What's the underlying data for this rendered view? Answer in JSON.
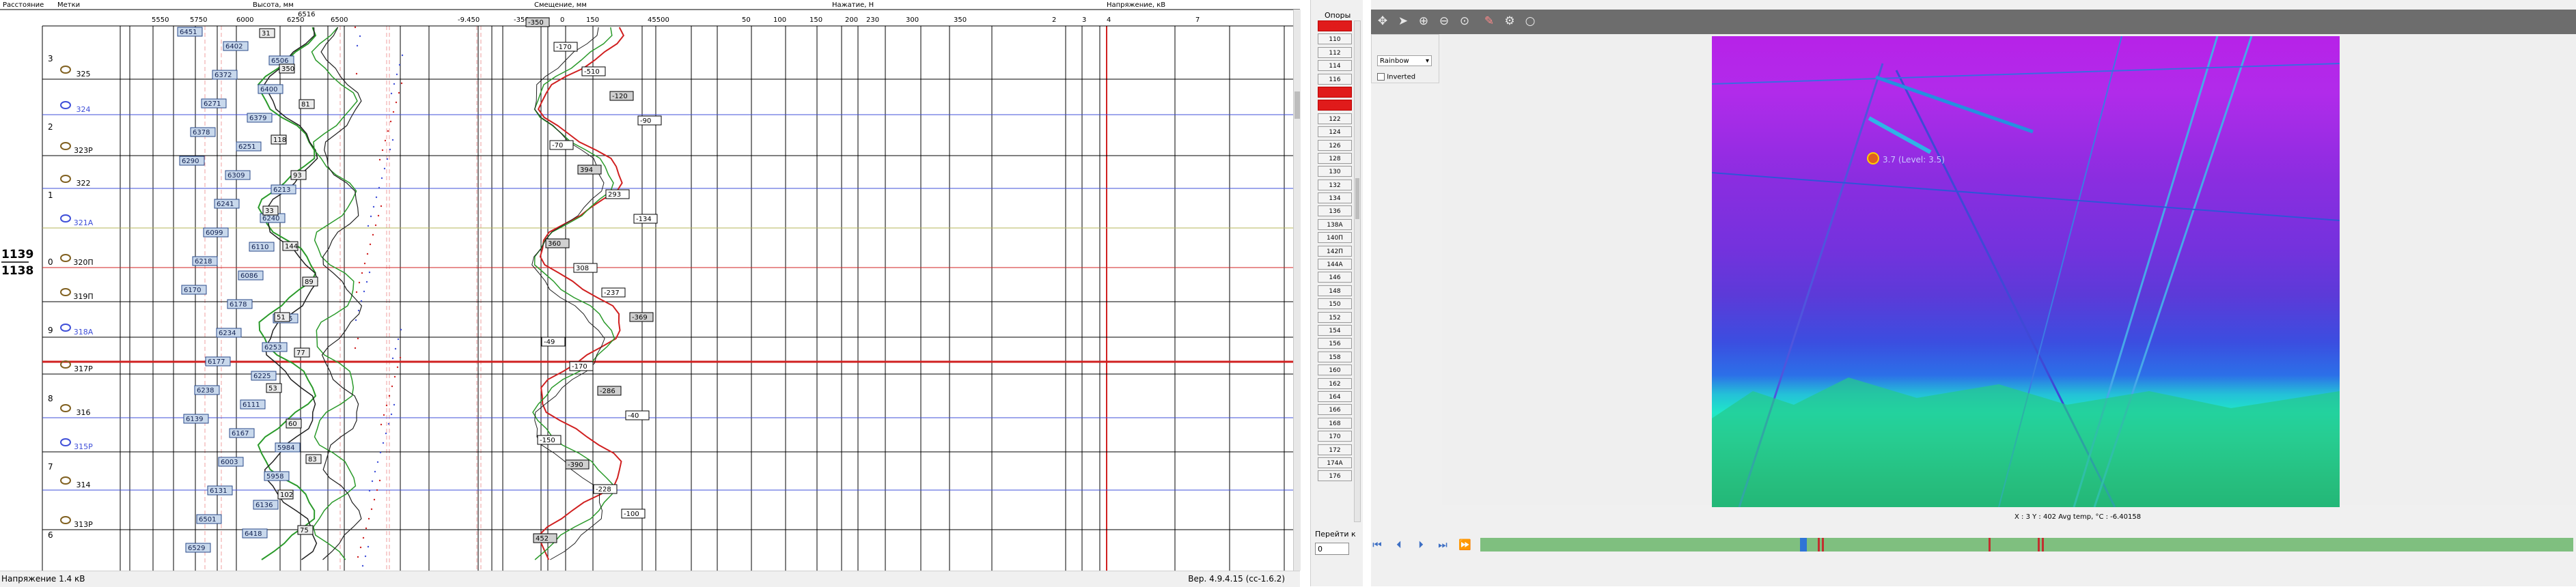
{
  "chart": {
    "headers": [
      "Расстояние",
      "Метки",
      "Высота, мм",
      "Смещение, мм",
      "Нажатие, Н",
      "Напряжение, кВ"
    ],
    "height_ticks": [
      "5550",
      "5750",
      "6000",
      "6250",
      "6516",
      "6500"
    ],
    "offset_ticks": [
      "-9.450",
      "-350",
      "0",
      "150",
      "45500"
    ],
    "force_ticks": [
      "50",
      "100",
      "150",
      "200",
      "230",
      "300",
      "350"
    ],
    "voltage_ticks": [
      "2",
      "3",
      "4",
      "7"
    ],
    "km_marks": [
      "3",
      "2",
      "1",
      "0",
      "9",
      "8",
      "7",
      "6"
    ],
    "km_big_top": "1139",
    "km_big_bottom": "1138",
    "pole_marks": [
      "325",
      "324",
      "323P",
      "322",
      "321А",
      "320П",
      "319П",
      "318А",
      "317P",
      "316",
      "315P",
      "314",
      "313P"
    ],
    "height_labels": [
      "6451",
      "6402",
      "6506",
      "6372",
      "6400",
      "6271",
      "6379",
      "6378",
      "6251",
      "6290",
      "6309",
      "6213",
      "6241",
      "6240",
      "6099",
      "6110",
      "6218",
      "6086",
      "6170",
      "6178",
      "6125",
      "6234",
      "6253",
      "6177",
      "6225",
      "6238",
      "6111",
      "6139",
      "6167",
      "5984",
      "6003",
      "5958",
      "6131",
      "6136",
      "6501",
      "6418",
      "6529"
    ],
    "offset_labels": [
      "-350",
      "-170",
      "-510",
      "-120",
      "-90",
      "-70",
      "394",
      "293",
      "-134",
      "360",
      "308",
      "-237",
      "-369",
      "-49",
      "-170",
      "-286",
      "-40",
      "-150",
      "-390",
      "-228",
      "-100",
      "452"
    ],
    "stagger_labels": [
      "31",
      "350",
      "81",
      "118",
      "93",
      "33",
      "144",
      "89",
      "51",
      "77",
      "53",
      "60",
      "83",
      "102",
      "75"
    ]
  },
  "status": {
    "left": "Напряжение 1.4 кВ",
    "right": "Вер. 4.9.4.15 (cc-1.6.2)"
  },
  "poles": {
    "title": "Опоры",
    "items": [
      "108",
      "110",
      "112",
      "114",
      "116",
      "118",
      "120",
      "122",
      "124",
      "126",
      "128",
      "130",
      "132",
      "134",
      "136",
      "138А",
      "140П",
      "142П",
      "144А",
      "146",
      "148",
      "150",
      "152",
      "154",
      "156",
      "158",
      "160",
      "162",
      "164",
      "166",
      "168",
      "170",
      "172",
      "174А",
      "176"
    ],
    "red_items": [
      "108",
      "118",
      "120"
    ],
    "goto_label": "Перейти к",
    "goto_value": "0"
  },
  "thermal": {
    "palette": "Rainbow",
    "inverted_label": "Inverted",
    "spot_label": "3.7 (Level: 3.5)",
    "info": "X : 3  Y : 402    Avg temp, °C : -6.40158"
  },
  "colors": {
    "grid": "#000000",
    "marker_blue": "#3f4fd8",
    "marker_red": "#d02020",
    "accent": "#e01b1b"
  }
}
